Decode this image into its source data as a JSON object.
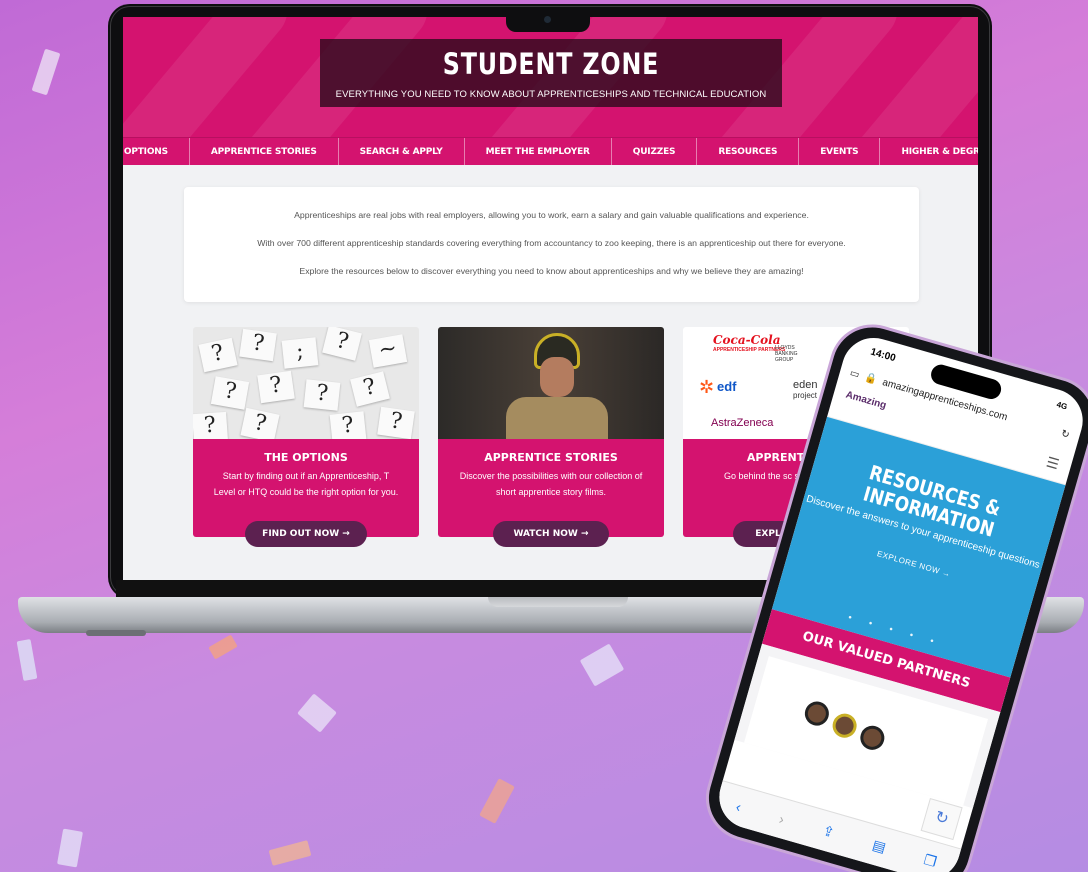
{
  "hero": {
    "title": "STUDENT ZONE",
    "subtitle": "EVERYTHING YOU NEED TO KNOW ABOUT APPRENTICESHIPS AND TECHNICAL EDUCATION"
  },
  "nav": {
    "items": [
      {
        "label": "E OPTIONS"
      },
      {
        "label": "APPRENTICE STORIES"
      },
      {
        "label": "SEARCH & APPLY"
      },
      {
        "label": "MEET THE EMPLOYER"
      },
      {
        "label": "QUIZZES"
      },
      {
        "label": "RESOURCES"
      },
      {
        "label": "EVENTS"
      },
      {
        "label": "HIGHER & DEGREE VACANCI"
      }
    ]
  },
  "intro": {
    "line1": "Apprenticeships are real jobs with real employers, allowing you to work, earn a salary and gain valuable qualifications and experience.",
    "line2": "With over 700 different apprenticeship standards covering everything from accountancy to zoo keeping, there is an apprenticeship out there for everyone.",
    "line3": "Explore the resources below to discover everything you need to know about apprenticeships and why we believe they are amazing!"
  },
  "cards": [
    {
      "title": "THE OPTIONS",
      "text": "Start by finding out if an Apprenticeship, T Level or HTQ could be the right option for you.",
      "button": "FIND OUT NOW →"
    },
    {
      "title": "APPRENTICE STORIES",
      "text": "Discover the possibilities with our collection of short apprentice story films.",
      "button": "WATCH NOW →"
    },
    {
      "title": "APPRENTICESHI",
      "text": "Go behind the sc some amazing em",
      "button": "EXPL"
    }
  ],
  "logos": {
    "coca": "Coca-Cola",
    "coca_sub": "APPRENTICESHIP PARTNERS",
    "lloyds": "LLOYDS BANKING GROUP",
    "edf": "edf",
    "eden": "eden",
    "eden_sub": "project",
    "astra": "AstraZeneca"
  },
  "phone": {
    "time": "14:00",
    "signal": "4G",
    "url": "amazingapprenticeships.com",
    "logo": "Amazing",
    "hero_title": "RESOURCES & INFORMATION",
    "hero_text": "Discover the answers to your apprenticeship questions",
    "hero_cta": "EXPLORE NOW →",
    "partners_title": "OUR VALUED PARTNERS"
  },
  "colors": {
    "brand_pink": "#d4136f",
    "button_plum": "#5c2150",
    "phone_blue": "#2ba0d8"
  }
}
